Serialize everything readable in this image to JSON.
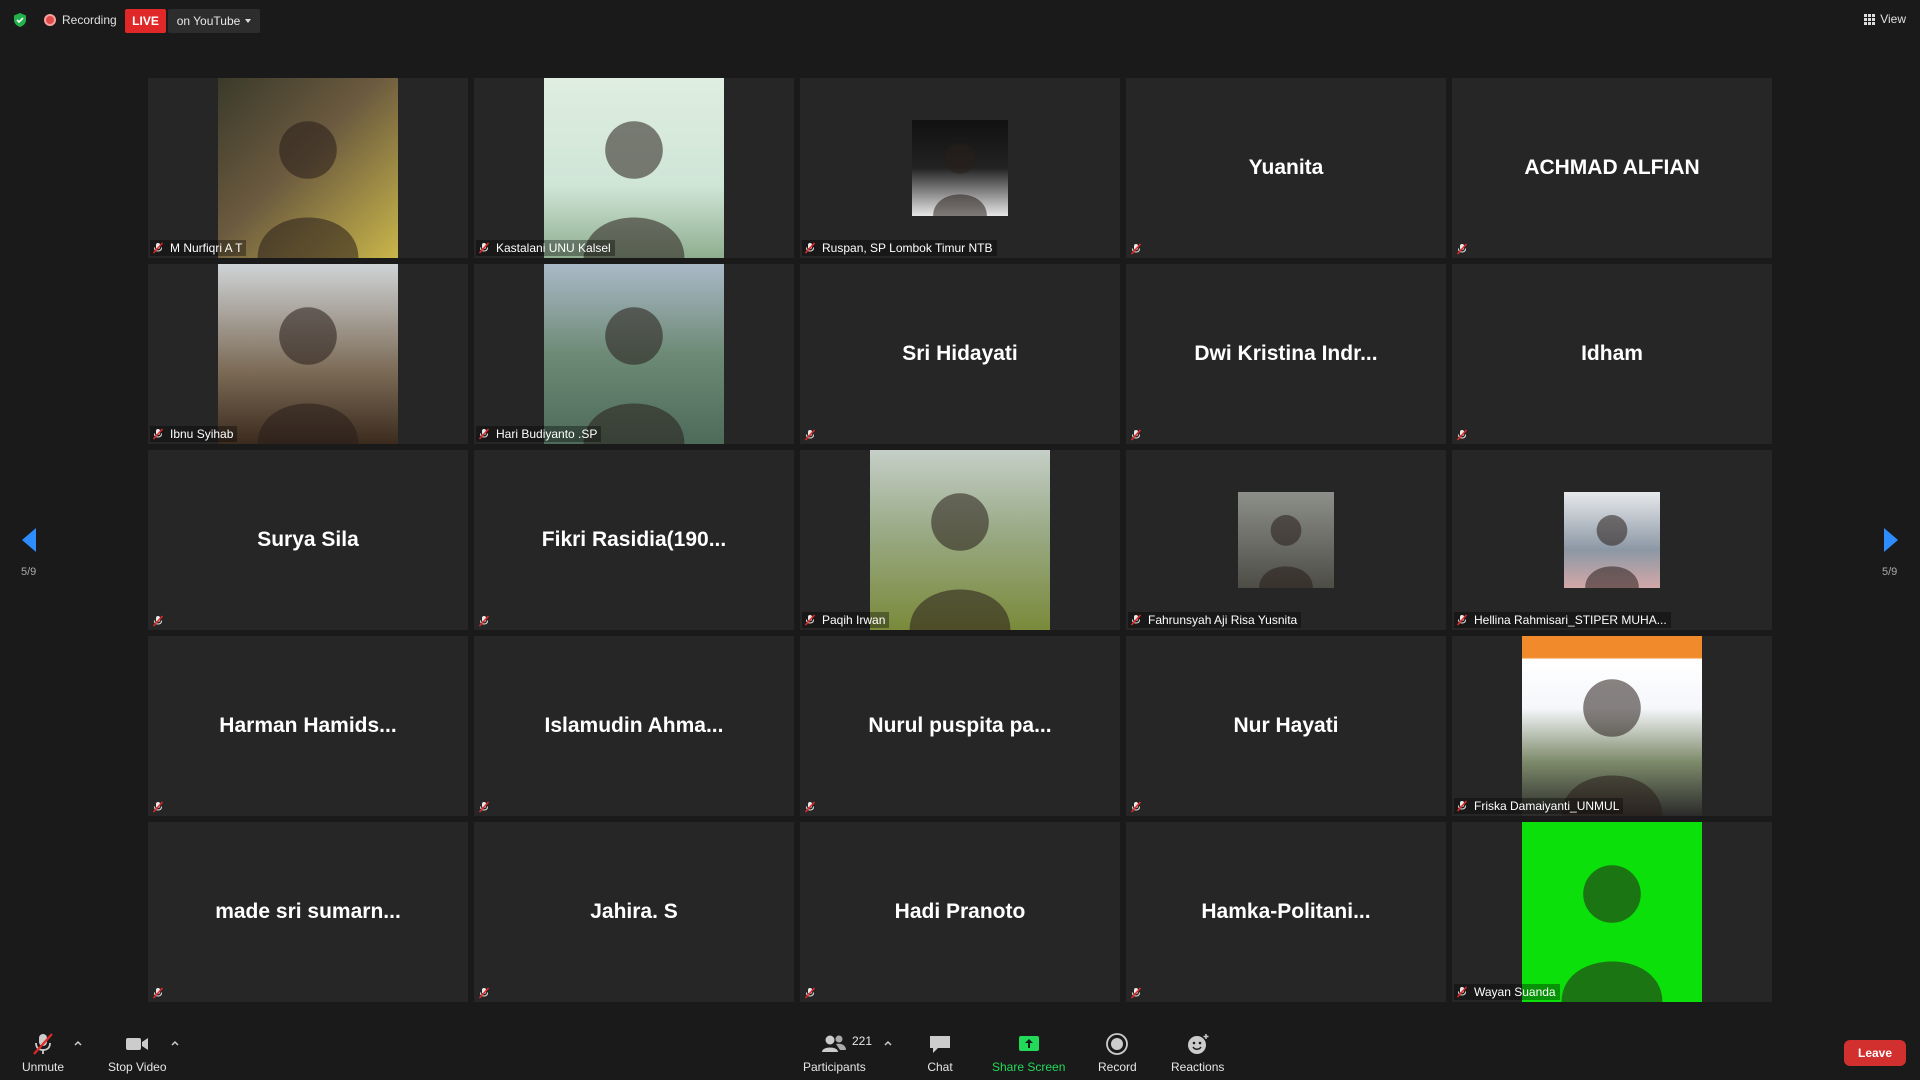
{
  "topbar": {
    "recording_label": "Recording",
    "live_label": "LIVE",
    "youtube_label": "on YouTube",
    "view_label": "View"
  },
  "gallery": {
    "page_indicator_left": "5/9",
    "page_indicator_right": "5/9",
    "tiles": [
      {
        "name": "M Nurfiqri A T",
        "has_video": true,
        "label": "M Nurfiqri A T"
      },
      {
        "name": "Kastalani UNU Kalsel",
        "has_video": true,
        "label": "Kastalani UNU Kalsel"
      },
      {
        "name": "Ruspan, SP Lombok Timur NTB",
        "has_video": true,
        "label": "Ruspan, SP Lombok Timur NTB"
      },
      {
        "name": "Yuanita",
        "has_video": false,
        "label": ""
      },
      {
        "name": "ACHMAD ALFIAN",
        "has_video": false,
        "label": ""
      },
      {
        "name": "Ibnu Syihab",
        "has_video": true,
        "label": "Ibnu Syihab"
      },
      {
        "name": "Hari Budiyanto .SP",
        "has_video": true,
        "label": "Hari Budiyanto .SP"
      },
      {
        "name": "Sri Hidayati",
        "has_video": false,
        "label": ""
      },
      {
        "name": "Dwi Kristina Indr...",
        "has_video": false,
        "label": ""
      },
      {
        "name": "Idham",
        "has_video": false,
        "label": ""
      },
      {
        "name": "Surya Sila",
        "has_video": false,
        "label": ""
      },
      {
        "name": "Fikri Rasidia(190...",
        "has_video": false,
        "label": ""
      },
      {
        "name": "Paqih Irwan",
        "has_video": true,
        "label": "Paqih Irwan"
      },
      {
        "name": "Fahrunsyah Aji Risa Yusnita",
        "has_video": true,
        "label": "Fahrunsyah Aji Risa Yusnita"
      },
      {
        "name": "Hellina Rahmisari_STIPER MUHA...",
        "has_video": true,
        "label": "Hellina Rahmisari_STIPER MUHA..."
      },
      {
        "name": "Harman Hamids...",
        "has_video": false,
        "label": ""
      },
      {
        "name": "Islamudin Ahma...",
        "has_video": false,
        "label": ""
      },
      {
        "name": "Nurul puspita pa...",
        "has_video": false,
        "label": ""
      },
      {
        "name": "Nur Hayati",
        "has_video": false,
        "label": ""
      },
      {
        "name": "Friska Damaiyanti_UNMUL",
        "has_video": true,
        "label": "Friska Damaiyanti_UNMUL"
      },
      {
        "name": "made sri sumarn...",
        "has_video": false,
        "label": ""
      },
      {
        "name": "Jahira. S",
        "has_video": false,
        "label": ""
      },
      {
        "name": "Hadi Pranoto",
        "has_video": false,
        "label": ""
      },
      {
        "name": "Hamka-Politani...",
        "has_video": false,
        "label": ""
      },
      {
        "name": "Wayan Suanda",
        "has_video": true,
        "label": "Wayan Suanda"
      }
    ]
  },
  "toolbar": {
    "unmute_label": "Unmute",
    "stop_video_label": "Stop Video",
    "participants_label": "Participants",
    "participants_count": "221",
    "chat_label": "Chat",
    "share_screen_label": "Share Screen",
    "record_label": "Record",
    "reactions_label": "Reactions",
    "leave_label": "Leave"
  },
  "colors": {
    "background": "#1a1a1a",
    "tile": "#262626",
    "live_red": "#e02828",
    "share_green": "#23d959",
    "leave_red": "#d2302f",
    "arrow_blue": "#2d8cff"
  }
}
